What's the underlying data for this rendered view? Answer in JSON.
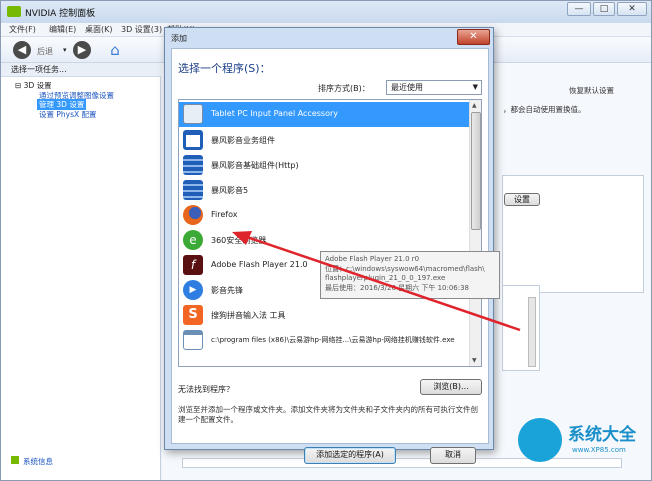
{
  "app": {
    "title": "NVIDIA 控制面板",
    "window_buttons": [
      "—",
      "□",
      "✕"
    ]
  },
  "menu": [
    "文件(F)",
    "编辑(E)",
    "桌面(K)",
    "3D 设置(3)",
    "帮助(H)"
  ],
  "toolbar": {
    "back_label": "后退",
    "back_icon": "◀",
    "forward_icon": "▶",
    "home_icon": "⌂"
  },
  "left_pane": {
    "header": "选择一项任务...",
    "tree_root": "3D 设置",
    "items": [
      "通过预览调整图像设置",
      "管理 3D 设置",
      "设置 PhysX 配置"
    ],
    "footer_link": "系统信息"
  },
  "right_pane": {
    "restore_default": "恢复默认设置",
    "hint": "，都会自动使用置换值。",
    "button_label": "设置"
  },
  "dialog": {
    "title": "添加",
    "close": "✕",
    "heading": "选择一个程序(S)：",
    "sort_label": "排序方式(B)：",
    "sort_value": "最近使用",
    "programs": [
      {
        "label": "Tablet PC Input Panel Accessory",
        "icon": "tablet-pen-icon",
        "color": "#e8eef6",
        "selected": true
      },
      {
        "label": "暴风影音业务组件",
        "icon": "baofeng-window-icon",
        "color": "#1f5fb8"
      },
      {
        "label": "暴风影音基础组件(Http)",
        "icon": "baofeng-film-icon",
        "color": "#1f5fb8"
      },
      {
        "label": "暴风影音5",
        "icon": "baofeng-film-icon",
        "color": "#1f5fb8"
      },
      {
        "label": "Firefox",
        "icon": "firefox-icon",
        "color": "#e8661c"
      },
      {
        "label": "360安全浏览器",
        "icon": "360-browser-icon",
        "color": "#3aa935"
      },
      {
        "label": "Adobe Flash Player 21.0",
        "icon": "flash-icon",
        "color": "#5a1010"
      },
      {
        "label": "影音先锋",
        "icon": "xfplay-icon",
        "color": "#2d7ee0"
      },
      {
        "label": "搜狗拼音输入法 工具",
        "icon": "sogou-icon",
        "color": "#f26522"
      },
      {
        "label": "c:\\program files (x86)\\云易游hp-网络挂...\\云易游hp-网络挂机赚钱软件.exe",
        "icon": "exe-file-icon",
        "color": "#6b8fb5"
      }
    ],
    "not_found": "无法找到程序？",
    "browse": "浏览(B)...",
    "description": "浏览至并添加一个程序或文件夹。添加文件夹将为文件夹和子文件夹内的所有可执行文件创建一个配置文件。",
    "add_button": "添加选定的程序(A)",
    "cancel_button": "取消"
  },
  "tooltip": {
    "lines": [
      "Adobe Flash Player 21.0 r0",
      "位置：c:\\windows\\syswow64\\macromed\\flash\\",
      "flashplayerplugin_21_0_0_197.exe",
      "最后使用：2016/3/26 星期六 下午 10:06:38"
    ]
  },
  "watermark": {
    "text": "系统大全",
    "url": "www.XP85.com"
  },
  "colors": {
    "selection": "#3399ff",
    "nvidia_green": "#76b900",
    "arrow": "#e0242c",
    "heading": "#1c3f88"
  }
}
